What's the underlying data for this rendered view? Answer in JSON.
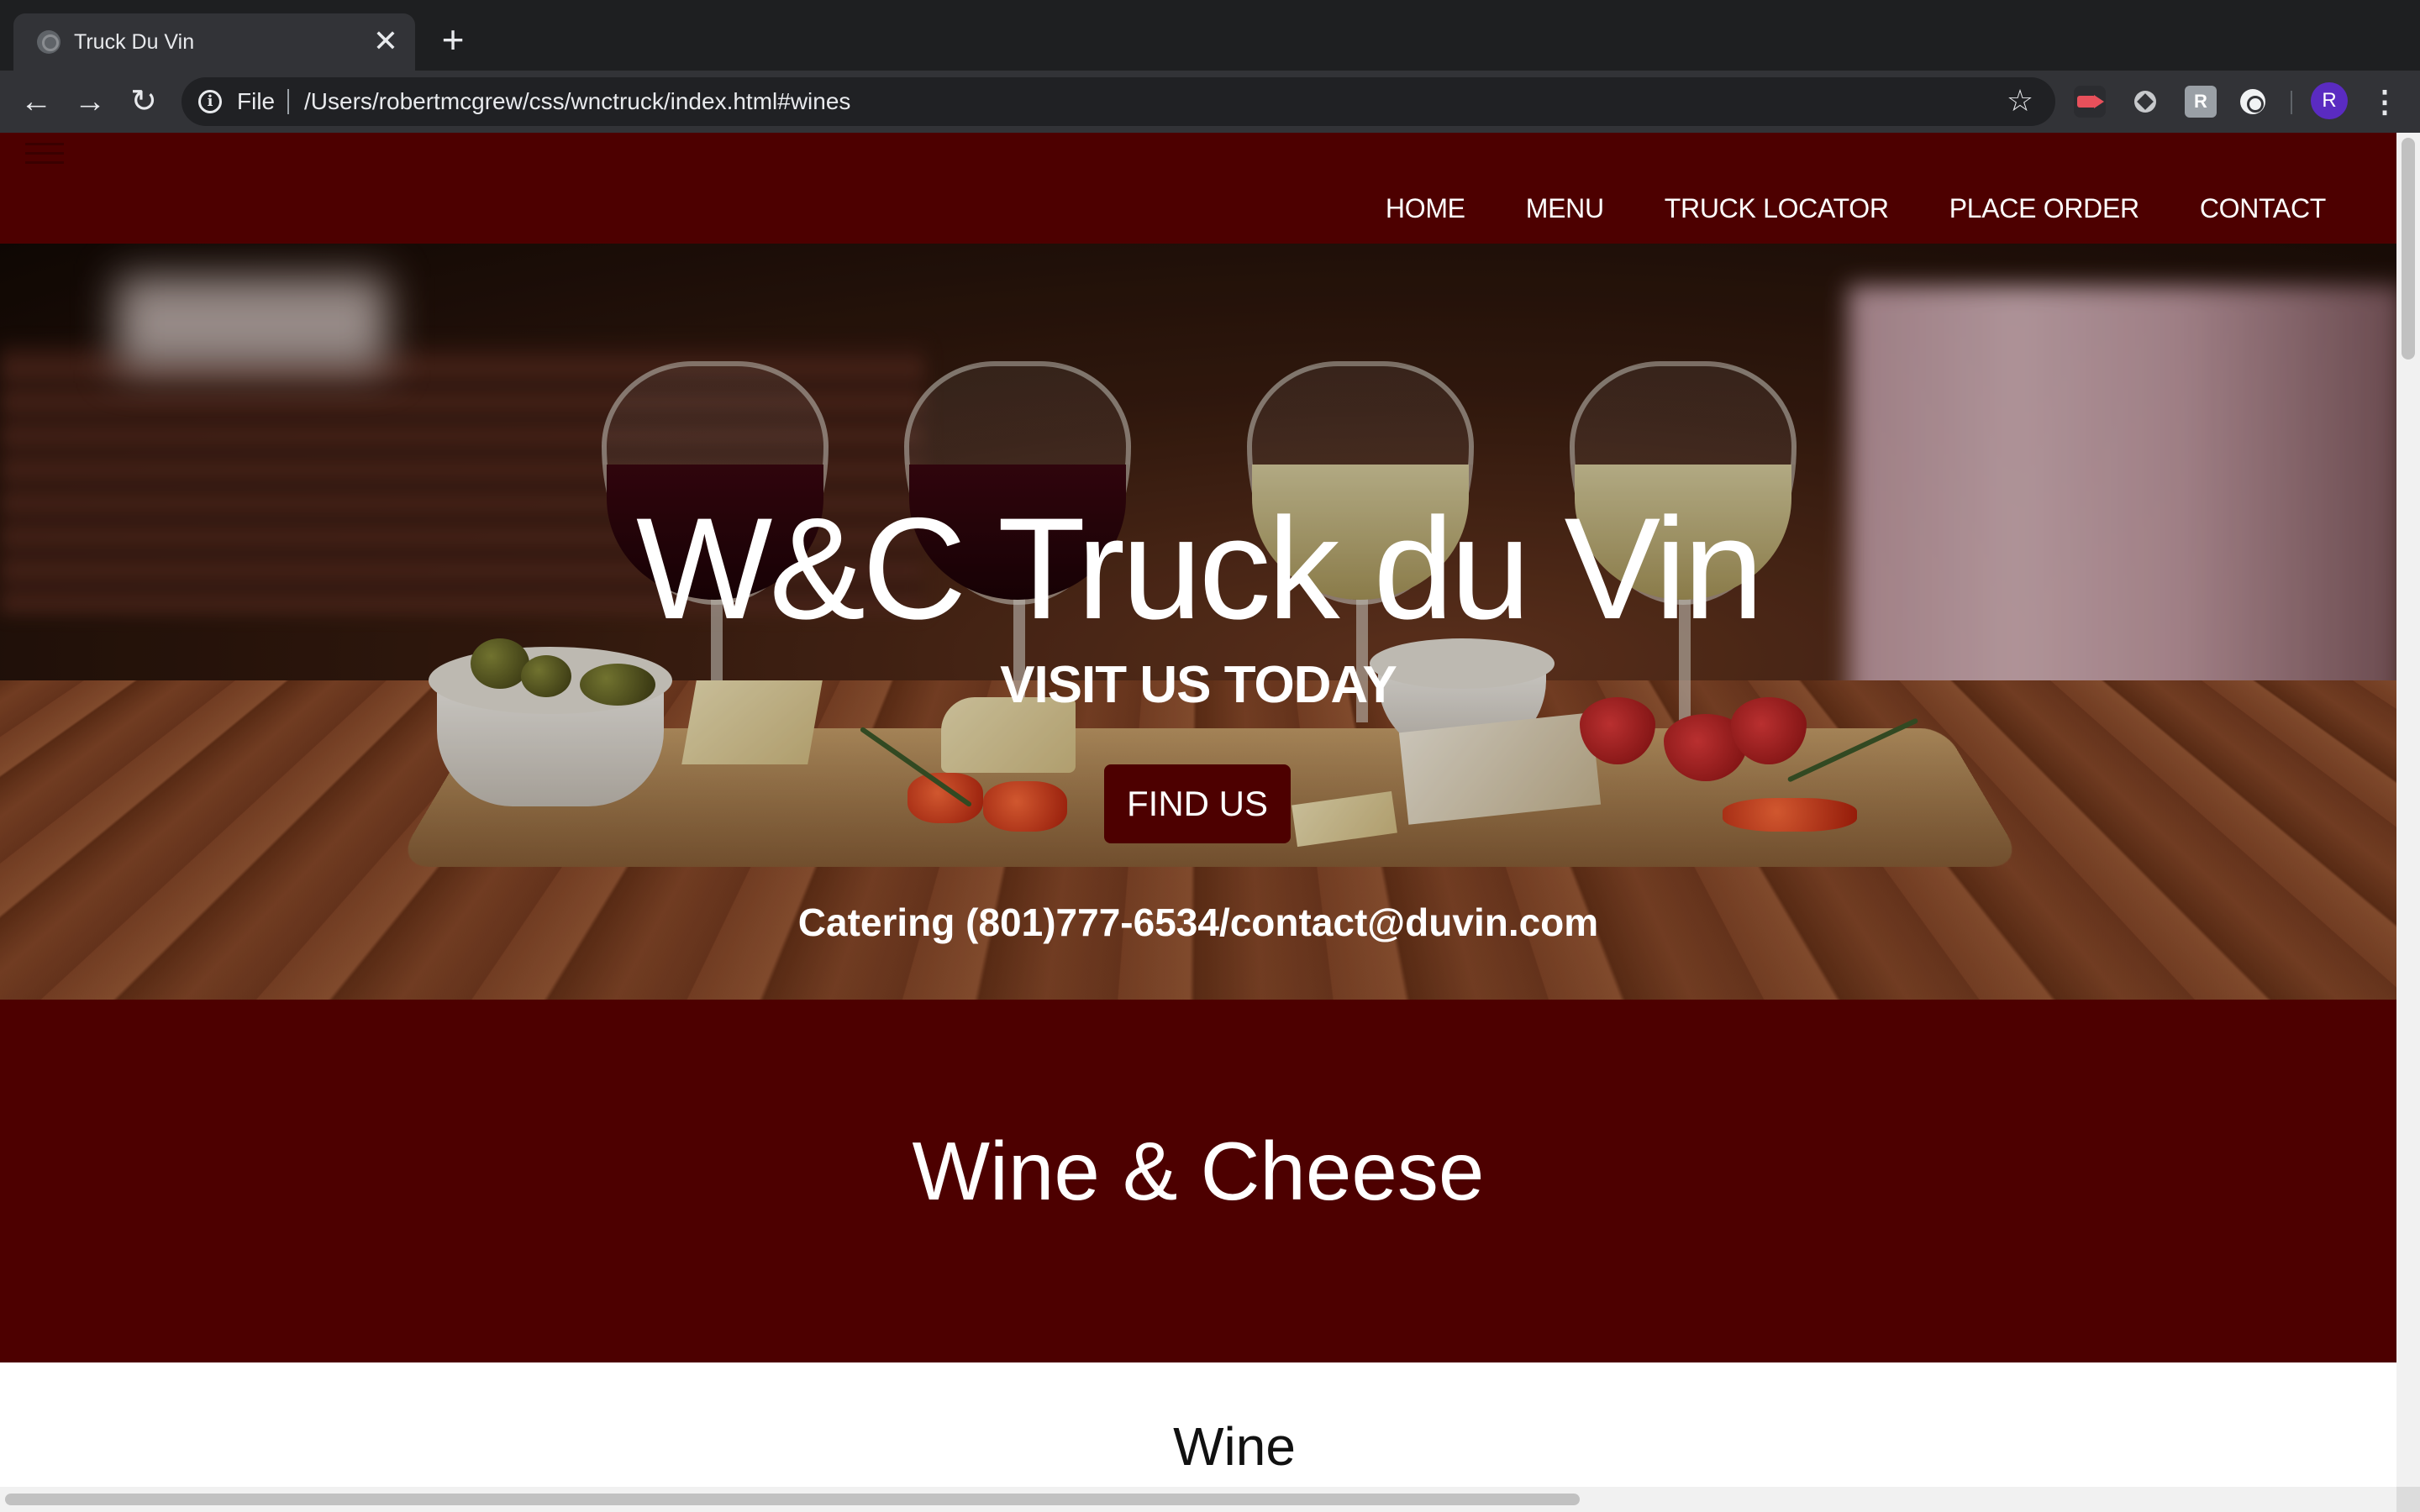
{
  "browser": {
    "tab_title": "Truck Du Vin",
    "tab_close": "✕",
    "new_tab": "+",
    "back": "←",
    "forward": "→",
    "reload": "↻",
    "scheme": "File",
    "url": "/Users/robertmcgrew/css/wnctruck/index.html#wines",
    "bookmark": "☆",
    "ext3_label": "R",
    "avatar_initial": "R",
    "menu": "⋮"
  },
  "site": {
    "nav": [
      "HOME",
      "MENU",
      "TRUCK LOCATOR",
      "PLACE ORDER",
      "CONTACT"
    ],
    "hero_title": "W&C Truck du Vin",
    "hero_subtitle": "VISIT US TODAY",
    "cta": "FIND US",
    "catering": "Catering (801)777-6534/contact@duvin.com",
    "section_title": "Wine & Cheese",
    "wine_heading": "Wine",
    "colors": {
      "brand": "#4d0000",
      "text_light": "#ffffff"
    }
  }
}
